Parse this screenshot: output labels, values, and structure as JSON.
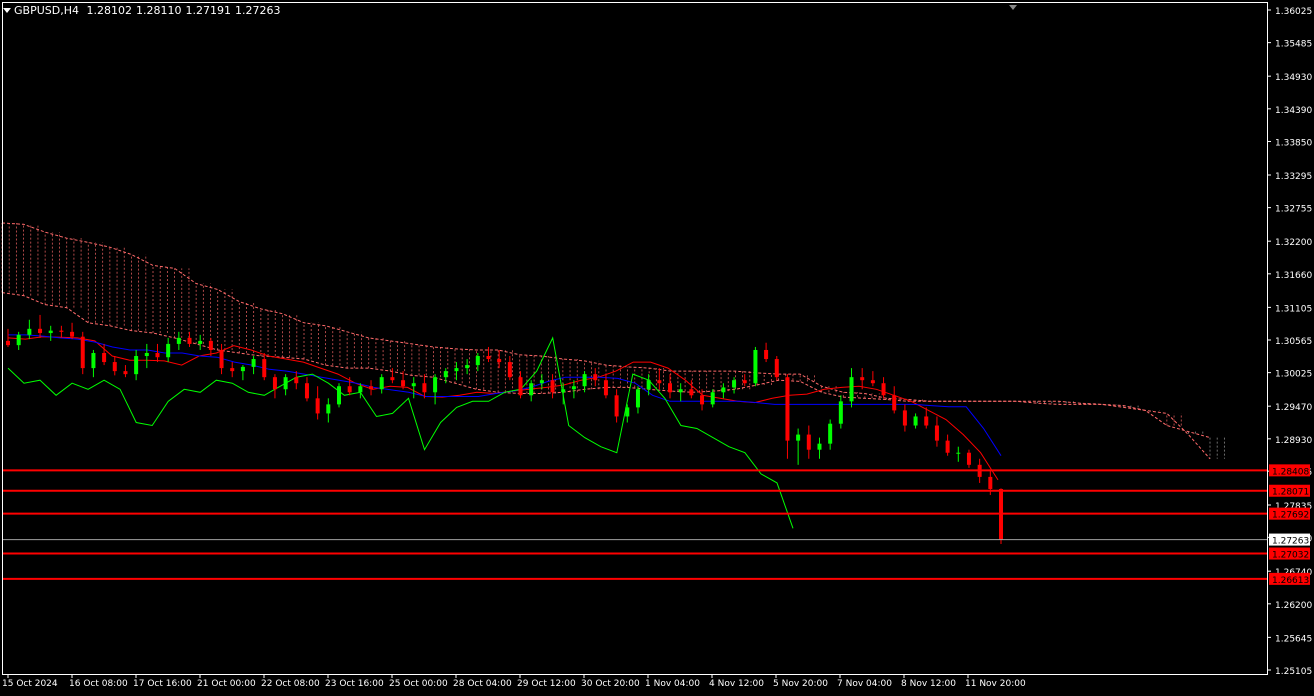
{
  "header": {
    "symbol": "GBPUSD,H4",
    "open": "1.28102",
    "high": "1.28110",
    "low": "1.27191",
    "close": "1.27263"
  },
  "colors": {
    "background": "#000000",
    "grid_frame": "#ffffff",
    "bull": "#00ff00",
    "bear": "#ff0000",
    "tenkan": "#ff0000",
    "kijun": "#0000ff",
    "chikou": "#00ff00",
    "cloud_bear": "#ff6a6a",
    "cloud_bull": "#a0a0a0",
    "hline": "#ff0000"
  },
  "chart_data": {
    "type": "candlestick",
    "ylim": [
      1.25105,
      1.36025
    ],
    "y_ticks": [
      "1.36025",
      "1.35485",
      "1.34930",
      "1.34390",
      "1.33850",
      "1.33295",
      "1.32755",
      "1.32200",
      "1.31660",
      "1.31105",
      "1.30565",
      "1.30025",
      "1.29470",
      "1.28930",
      "1.28395",
      "1.27835",
      "1.27300",
      "1.26740",
      "1.26200",
      "1.25645",
      "1.25105"
    ],
    "x_ticks": [
      "15 Oct 2024",
      "16 Oct 08:00",
      "17 Oct 16:00",
      "21 Oct 00:00",
      "22 Oct 08:00",
      "23 Oct 16:00",
      "25 Oct 00:00",
      "28 Oct 04:00",
      "29 Oct 12:00",
      "30 Oct 20:00",
      "1 Nov 04:00",
      "4 Nov 12:00",
      "5 Nov 20:00",
      "7 Nov 04:00",
      "8 Nov 12:00",
      "11 Nov 20:00"
    ],
    "current_price": "1.27263",
    "price_levels": [
      "1.28408",
      "1.28071",
      "1.27692",
      "1.27032",
      "1.26613"
    ],
    "series": [
      {
        "name": "Tenkan-sen",
        "values": [
          1.306,
          1.3058,
          1.3062,
          1.3061,
          1.306,
          1.3055,
          1.303,
          1.3023,
          1.3023,
          1.3022,
          1.3015,
          1.303,
          1.3035,
          1.3047,
          1.304,
          1.303,
          1.3025,
          1.302,
          1.301,
          1.3,
          1.2985,
          1.2975,
          1.298,
          1.2978,
          1.2963,
          1.2962,
          1.2965,
          1.297,
          1.2968,
          1.2972,
          1.2975,
          1.2978,
          1.2982,
          1.299,
          1.2995,
          1.3005,
          1.302,
          1.302,
          1.301,
          1.299,
          1.2965,
          1.296,
          1.2955,
          1.2953,
          1.296,
          1.2965,
          1.2967,
          1.2975,
          1.2978,
          1.298,
          1.2975,
          1.2965,
          1.2955,
          1.294,
          1.2925,
          1.29,
          1.287,
          1.2825
        ]
      },
      {
        "name": "Kijun-sen",
        "values": [
          1.3065,
          1.3065,
          1.3063,
          1.306,
          1.3058,
          1.3053,
          1.3045,
          1.304,
          1.304,
          1.3035,
          1.3035,
          1.303,
          1.3028,
          1.302,
          1.3015,
          1.3008,
          1.3005,
          1.3,
          1.2995,
          1.299,
          1.2985,
          1.2978,
          1.2974,
          1.297,
          1.2963,
          1.2963,
          1.2963,
          1.2963,
          1.2968,
          1.2972,
          1.2978,
          1.2988,
          1.2995,
          1.2995,
          1.2995,
          1.2993,
          1.2985,
          1.2965,
          1.2955,
          1.2955,
          1.2955,
          1.2955,
          1.2955,
          1.2953,
          1.295,
          1.295,
          1.295,
          1.295,
          1.295,
          1.295,
          1.295,
          1.295,
          1.295,
          1.2948,
          1.2946,
          1.2946,
          1.291,
          1.2865
        ]
      },
      {
        "name": "Chikou Span",
        "values": [
          1.301,
          1.2985,
          1.299,
          1.2965,
          1.2985,
          1.2975,
          1.299,
          1.2975,
          1.292,
          1.2915,
          1.2955,
          1.2975,
          1.297,
          1.299,
          1.2985,
          1.297,
          1.2965,
          1.298,
          1.2995,
          1.3,
          1.2985,
          1.2965,
          1.297,
          1.293,
          1.2935,
          1.296,
          1.2875,
          1.292,
          1.2945,
          1.2955,
          1.2955,
          1.297,
          1.2975,
          1.3005,
          1.306,
          1.2915,
          1.2895,
          1.288,
          1.287,
          1.3,
          1.299,
          1.296,
          1.2915,
          1.291,
          1.2895,
          1.288,
          1.287,
          1.2835,
          1.282,
          1.2745
        ]
      },
      {
        "name": "Senkou Span A",
        "values": [
          1.3135,
          1.313,
          1.3115,
          1.311,
          1.3085,
          1.308,
          1.3072,
          1.3068,
          1.306,
          1.305,
          1.304,
          1.3035,
          1.303,
          1.3028,
          1.3025,
          1.3015,
          1.301,
          1.301,
          1.3005,
          1.2998,
          1.2995,
          1.2985,
          1.2975,
          1.297,
          1.2968,
          1.2968,
          1.297,
          1.2975,
          1.2978,
          1.2978,
          1.2975,
          1.2972,
          1.297,
          1.2972,
          1.2975,
          1.2982,
          1.299,
          1.2988,
          1.297,
          1.2962,
          1.296,
          1.2958,
          1.2955,
          1.2955,
          1.2955,
          1.2955,
          1.2955,
          1.2955,
          1.2955,
          1.2955,
          1.2952,
          1.295,
          1.2948,
          1.294,
          1.2915,
          1.2905,
          1.2895
        ]
      },
      {
        "name": "Senkou Span B",
        "values": [
          1.325,
          1.3248,
          1.3235,
          1.3225,
          1.3218,
          1.321,
          1.3198,
          1.318,
          1.3175,
          1.315,
          1.314,
          1.312,
          1.3108,
          1.31,
          1.3085,
          1.308,
          1.307,
          1.306,
          1.3055,
          1.305,
          1.3045,
          1.3042,
          1.304,
          1.304,
          1.3032,
          1.303,
          1.3025,
          1.3022,
          1.3015,
          1.3012,
          1.301,
          1.3005,
          1.3005,
          1.3005,
          1.3005,
          1.3002,
          1.3,
          1.3,
          1.298,
          1.297,
          1.2968,
          1.296,
          1.2958,
          1.2955,
          1.2955,
          1.2955,
          1.2955,
          1.2955,
          1.2952,
          1.295,
          1.295,
          1.295,
          1.2945,
          1.294,
          1.2935,
          1.29,
          1.286
        ]
      },
      {
        "name": "Candles",
        "ohlc": [
          [
            1.3055,
            1.3075,
            1.3045,
            1.3048
          ],
          [
            1.3048,
            1.307,
            1.304,
            1.3065
          ],
          [
            1.3065,
            1.309,
            1.3058,
            1.3075
          ],
          [
            1.3075,
            1.3098,
            1.306,
            1.3068
          ],
          [
            1.3068,
            1.308,
            1.3055,
            1.3072
          ],
          [
            1.3072,
            1.308,
            1.306,
            1.307
          ],
          [
            1.307,
            1.3085,
            1.3058,
            1.3062
          ],
          [
            1.3062,
            1.307,
            1.3,
            1.301
          ],
          [
            1.301,
            1.304,
            1.2995,
            1.3035
          ],
          [
            1.3035,
            1.305,
            1.3015,
            1.302
          ],
          [
            1.302,
            1.303,
            1.2998,
            1.3005
          ],
          [
            1.3005,
            1.3015,
            1.2995,
            1.3
          ],
          [
            1.3,
            1.304,
            1.299,
            1.303
          ],
          [
            1.303,
            1.305,
            1.301,
            1.3035
          ],
          [
            1.3035,
            1.305,
            1.302,
            1.3028
          ],
          [
            1.3028,
            1.306,
            1.302,
            1.305
          ],
          [
            1.305,
            1.307,
            1.304,
            1.306
          ],
          [
            1.306,
            1.307,
            1.3045,
            1.305
          ],
          [
            1.305,
            1.3065,
            1.304,
            1.3055
          ],
          [
            1.3055,
            1.306,
            1.303,
            1.304
          ],
          [
            1.304,
            1.305,
            1.3,
            1.301
          ],
          [
            1.301,
            1.302,
            1.2995,
            1.3005
          ],
          [
            1.3005,
            1.3015,
            1.299,
            1.3012
          ],
          [
            1.3012,
            1.303,
            1.3,
            1.3025
          ],
          [
            1.3025,
            1.3035,
            1.299,
            1.2995
          ],
          [
            1.2995,
            1.3,
            1.296,
            1.2975
          ],
          [
            1.2975,
            1.3,
            1.2965,
            1.2995
          ],
          [
            1.2995,
            1.3005,
            1.2975,
            1.2985
          ],
          [
            1.2985,
            1.2995,
            1.2955,
            1.296
          ],
          [
            1.296,
            1.298,
            1.2925,
            1.2935
          ],
          [
            1.2935,
            1.296,
            1.292,
            1.295
          ],
          [
            1.295,
            1.2985,
            1.2945,
            1.298
          ],
          [
            1.298,
            1.2995,
            1.2965,
            1.297
          ],
          [
            1.297,
            1.2985,
            1.296,
            1.298
          ],
          [
            1.298,
            1.299,
            1.2965,
            1.2975
          ],
          [
            1.2975,
            1.3,
            1.2968,
            1.2995
          ],
          [
            1.2995,
            1.301,
            1.2985,
            1.299
          ],
          [
            1.299,
            1.3005,
            1.2975,
            1.298
          ],
          [
            1.298,
            1.2995,
            1.296,
            1.2985
          ],
          [
            1.2985,
            1.3,
            1.296,
            1.297
          ],
          [
            1.297,
            1.3,
            1.295,
            1.2995
          ],
          [
            1.2995,
            1.301,
            1.2985,
            1.3005
          ],
          [
            1.3005,
            1.302,
            1.299,
            1.301
          ],
          [
            1.301,
            1.3025,
            1.3,
            1.3015
          ],
          [
            1.3015,
            1.3035,
            1.3005,
            1.303
          ],
          [
            1.303,
            1.3045,
            1.302,
            1.3025
          ],
          [
            1.3025,
            1.304,
            1.301,
            1.302
          ],
          [
            1.302,
            1.303,
            1.299,
            1.2995
          ],
          [
            1.2995,
            1.3005,
            1.296,
            1.2965
          ],
          [
            1.2965,
            1.299,
            1.2955,
            1.2985
          ],
          [
            1.2985,
            1.3,
            1.2975,
            1.299
          ],
          [
            1.299,
            1.3,
            1.296,
            1.297
          ],
          [
            1.297,
            1.2985,
            1.295,
            1.2975
          ],
          [
            1.2975,
            1.299,
            1.296,
            1.298
          ],
          [
            1.298,
            1.3005,
            1.297,
            1.3
          ],
          [
            1.3,
            1.301,
            1.298,
            1.299
          ],
          [
            1.299,
            1.3,
            1.296,
            1.2965
          ],
          [
            1.2965,
            1.2975,
            1.292,
            1.293
          ],
          [
            1.293,
            1.295,
            1.292,
            1.2945
          ],
          [
            1.2945,
            1.298,
            1.2935,
            1.2975
          ],
          [
            1.2975,
            1.3,
            1.2965,
            1.299
          ],
          [
            1.299,
            1.301,
            1.2975,
            1.2985
          ],
          [
            1.2985,
            1.3,
            1.296,
            1.297
          ],
          [
            1.297,
            1.2985,
            1.2955,
            1.2975
          ],
          [
            1.2975,
            1.299,
            1.296,
            1.2965
          ],
          [
            1.2965,
            1.2975,
            1.294,
            1.295
          ],
          [
            1.295,
            1.2975,
            1.2945,
            1.297
          ],
          [
            1.297,
            1.2985,
            1.296,
            1.2978
          ],
          [
            1.2978,
            1.2995,
            1.2968,
            1.299
          ],
          [
            1.299,
            1.3,
            1.298,
            1.2985
          ],
          [
            1.2985,
            1.3045,
            1.298,
            1.304
          ],
          [
            1.304,
            1.3052,
            1.302,
            1.3025
          ],
          [
            1.3025,
            1.303,
            1.299,
            1.2995
          ],
          [
            1.2995,
            1.3,
            1.286,
            1.289
          ],
          [
            1.289,
            1.291,
            1.285,
            1.29
          ],
          [
            1.29,
            1.2915,
            1.286,
            1.2875
          ],
          [
            1.2875,
            1.2895,
            1.286,
            1.2885
          ],
          [
            1.2885,
            1.2925,
            1.2875,
            1.2918
          ],
          [
            1.2918,
            1.2965,
            1.291,
            1.2955
          ],
          [
            1.2955,
            1.301,
            1.2945,
            1.2995
          ],
          [
            1.2995,
            1.301,
            1.2975,
            1.299
          ],
          [
            1.299,
            1.3005,
            1.298,
            1.2985
          ],
          [
            1.2985,
            1.2995,
            1.296,
            1.2965
          ],
          [
            1.2965,
            1.298,
            1.2935,
            1.294
          ],
          [
            1.294,
            1.295,
            1.2905,
            1.2915
          ],
          [
            1.2915,
            1.2935,
            1.291,
            1.293
          ],
          [
            1.293,
            1.2945,
            1.291,
            1.2915
          ],
          [
            1.2915,
            1.293,
            1.288,
            1.289
          ],
          [
            1.289,
            1.29,
            1.2865,
            1.287
          ],
          [
            1.287,
            1.288,
            1.2855,
            1.287
          ],
          [
            1.287,
            1.2875,
            1.2845,
            1.285
          ],
          [
            1.285,
            1.286,
            1.282,
            1.283
          ],
          [
            1.283,
            1.284,
            1.28,
            1.281
          ],
          [
            1.281,
            1.2811,
            1.2719,
            1.2726
          ]
        ]
      }
    ]
  }
}
